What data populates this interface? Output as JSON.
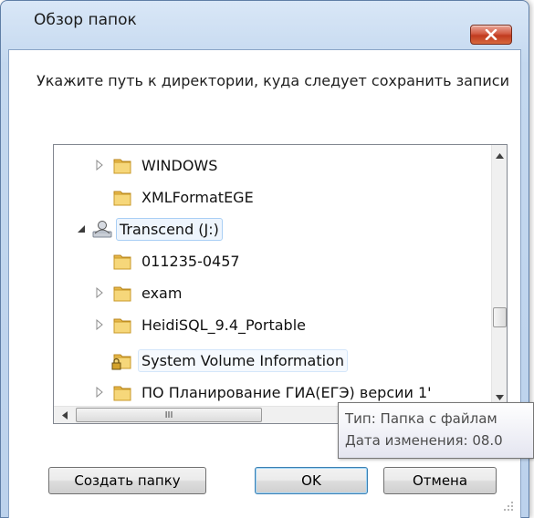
{
  "window": {
    "title": "Обзор папок",
    "prompt": "Укажите путь к директории, куда следует сохранить записи"
  },
  "tree": {
    "items": [
      {
        "label": "WINDOWS",
        "icon": "folder-icon",
        "expander": "collapsed"
      },
      {
        "label": "XMLFormatEGE",
        "icon": "folder-icon",
        "expander": "none"
      },
      {
        "label": "Transcend (J:)",
        "icon": "user-drive-icon",
        "expander": "expanded"
      },
      {
        "label": "011235-0457",
        "icon": "folder-icon",
        "expander": "none"
      },
      {
        "label": "exam",
        "icon": "folder-icon",
        "expander": "collapsed"
      },
      {
        "label": "HeidiSQL_9.4_Portable",
        "icon": "folder-icon",
        "expander": "collapsed"
      },
      {
        "label": "System Volume Information",
        "icon": "locked-folder-icon",
        "expander": "none"
      },
      {
        "label": "ПО Планирование ГИА(ЕГЭ) версии 1'",
        "icon": "folder-icon",
        "expander": "collapsed"
      }
    ],
    "hscroll_grip": "III"
  },
  "tooltip": {
    "line1": "Тип: Папка с файлам",
    "line2": "Дата изменения: 08.0"
  },
  "buttons": {
    "new_folder": "Создать папку",
    "ok": "OK",
    "cancel": "Отмена"
  },
  "colors": {
    "close_button": "#c13a1f",
    "selection": "#a9cff5",
    "folder": "#e8b84a"
  }
}
